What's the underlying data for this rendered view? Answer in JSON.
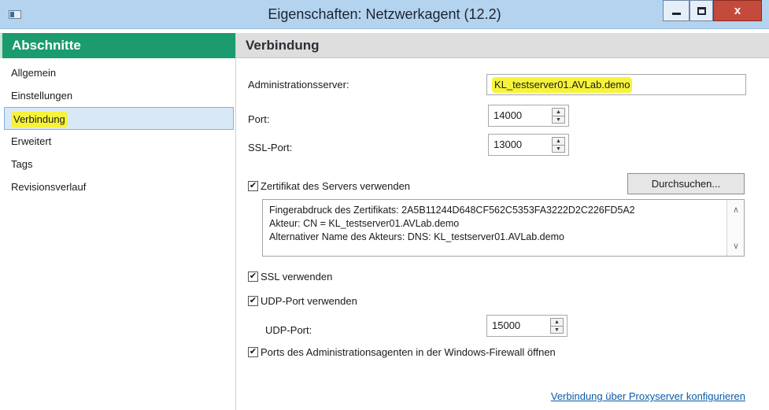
{
  "window": {
    "title": "Eigenschaften: Netzwerkagent (12.2)",
    "close_label": "x"
  },
  "sidebar": {
    "header": "Abschnitte",
    "items": [
      {
        "label": "Allgemein"
      },
      {
        "label": "Einstellungen"
      },
      {
        "label": "Verbindung",
        "selected": true
      },
      {
        "label": "Erweitert"
      },
      {
        "label": "Tags"
      },
      {
        "label": "Revisionsverlauf"
      }
    ]
  },
  "content": {
    "header": "Verbindung",
    "admin_server_label": "Administrationsserver:",
    "admin_server_value": "KL_testserver01.AVLab.demo",
    "port_label": "Port:",
    "port_value": "14000",
    "ssl_port_label": "SSL-Port:",
    "ssl_port_value": "13000",
    "use_cert_label": "Zertifikat des Servers verwenden",
    "use_cert_checked": true,
    "browse_label": "Durchsuchen...",
    "cert_lines": [
      "Fingerabdruck des Zertifikats: 2A5B11244D648CF562C5353FA3222D2C226FD5A2",
      "Akteur: CN = KL_testserver01.AVLab.demo",
      "Alternativer Name des Akteurs: DNS: KL_testserver01.AVLab.demo"
    ],
    "use_ssl_label": "SSL verwenden",
    "use_ssl_checked": true,
    "use_udp_label": "UDP-Port verwenden",
    "use_udp_checked": true,
    "udp_port_label": "UDP-Port:",
    "udp_port_value": "15000",
    "firewall_label": "Ports des Administrationsagenten in der Windows-Firewall öffnen",
    "firewall_checked": true,
    "proxy_link": "Verbindung über Proxyserver konfigurieren"
  },
  "colors": {
    "sidebar_header": "#1b9b6e",
    "titlebar": "#b4d3ef",
    "highlight": "#f7f33a",
    "selection": "#d8e8f7",
    "link": "#0b5aa8",
    "close_button": "#c44a3c"
  },
  "icons": {
    "check": "✔",
    "spin_up": "▲",
    "spin_down": "▼",
    "scroll_up": "∧",
    "scroll_down": "∨"
  }
}
